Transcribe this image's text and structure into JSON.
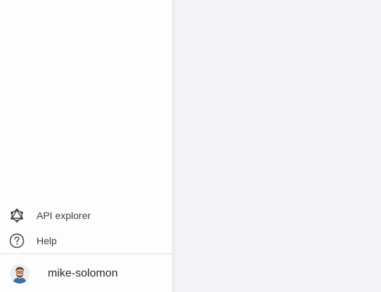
{
  "sidebar": {
    "nav_items": [
      {
        "label": "API explorer",
        "icon": "graphql-icon"
      },
      {
        "label": "Help",
        "icon": "help-circle-icon"
      }
    ],
    "user": {
      "name": "mike-solomon",
      "avatar": "user-avatar"
    }
  }
}
